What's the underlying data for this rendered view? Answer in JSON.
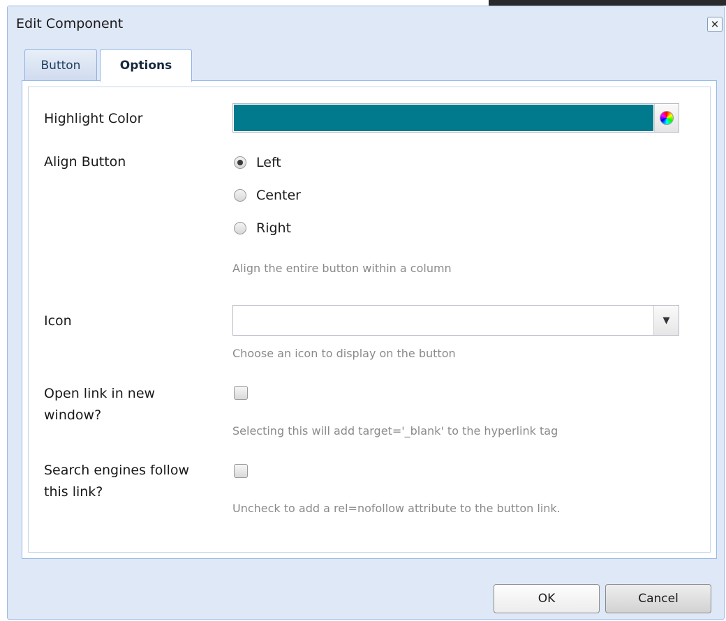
{
  "dialog": {
    "title": "Edit Component",
    "close_symbol": "✕"
  },
  "tabs": [
    {
      "label": "Button",
      "active": false
    },
    {
      "label": "Options",
      "active": true
    }
  ],
  "form": {
    "highlight_color": {
      "label": "Highlight Color",
      "value": "#007a8c",
      "trigger_icon": "color-wheel-icon"
    },
    "align_button": {
      "label": "Align Button",
      "options": [
        "Left",
        "Center",
        "Right"
      ],
      "selected": "Left",
      "hint": "Align the entire button within a column"
    },
    "icon": {
      "label": "Icon",
      "value": "",
      "trigger_icon": "chevron-down-icon",
      "hint": "Choose an icon to display on the button"
    },
    "open_new_window": {
      "label_line1": "Open link in new",
      "label_line2": "window?",
      "checked": false,
      "hint": "Selecting this will add target='_blank' to the hyperlink tag"
    },
    "search_follow": {
      "label_line1": "Search engines follow",
      "label_line2": "this link?",
      "checked": false,
      "hint": "Uncheck to add a rel=nofollow attribute to the button link."
    }
  },
  "footer": {
    "ok_label": "OK",
    "cancel_label": "Cancel"
  }
}
